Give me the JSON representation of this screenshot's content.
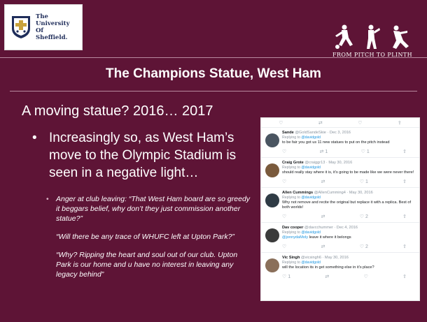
{
  "header": {
    "university": [
      "The",
      "University",
      "Of",
      "Sheffield."
    ],
    "brand_text": "FROM PITCH TO PLINTH"
  },
  "title": "The Champions Statue, West Ham",
  "subtitle": "A moving statue? 2016… 2017",
  "bullet1": {
    "marker": "•",
    "text": "Increasingly so, as West Ham’s move to the Olympic Stadium is seen in a negative light…"
  },
  "quotes": {
    "marker": "•",
    "q1": "Anger at club leaving: “That West Ham board are so greedy it beggars belief, why don’t they just commission another statue?”",
    "q2": "“Will there be any trace of WHUFC left at Upton Park?”",
    "q3": "“Why? Ripping the heart and soul out of our club. Upton Park is our home and u have no interest in leaving any legacy behind”"
  },
  "tweets": {
    "top_actions": [
      "♡",
      "⇄",
      "♡",
      "⇪"
    ],
    "items": [
      {
        "name": "Sande",
        "handle": "@GoldSandeSkie · Dec 3, 2016",
        "reply": "Replying to",
        "reply_to": "@davidgold",
        "body": "to be fair you got us 11 new statues to put on the pitch instead",
        "actions": [
          "♡",
          "⇄ 1",
          "♡ 1",
          "⇪"
        ]
      },
      {
        "name": "Craig Grote",
        "handle": "@craiggr13 · May 30, 2016",
        "reply": "Replying to",
        "reply_to": "@davidgold",
        "body": "should really stay where it is, it's going to be made like we were never there!",
        "actions": [
          "♡",
          "⇄",
          "♡ 1",
          "⇪"
        ]
      },
      {
        "name": "Allen Cummings",
        "handle": "@AllenCumming4 · May 30, 2016",
        "reply": "Replying to",
        "reply_to": "@davidgold",
        "body": "Why not remove and recite the original but replace it with a replica. Best of both worlds!",
        "actions": [
          "♡",
          "⇄",
          "♡ 2",
          "⇪"
        ]
      },
      {
        "name": "Dav cooper",
        "handle": "@davcchummer · Dec 4, 2016",
        "reply": "Replying to",
        "reply_to": "@davidgold",
        "body_link": "@jonnydaMoly",
        "body": "leave it where it belongs",
        "actions": [
          "♡",
          "⇄",
          "♡ 2",
          "⇪"
        ]
      },
      {
        "name": "Vic Singh",
        "handle": "@vicsingh6 · May 30, 2016",
        "reply": "Replying to",
        "reply_to": "@davidgold",
        "body": "will the location its in get something else in it's place?",
        "actions": [
          "♡ 1",
          "⇄",
          "♡",
          "⇪"
        ]
      }
    ]
  }
}
